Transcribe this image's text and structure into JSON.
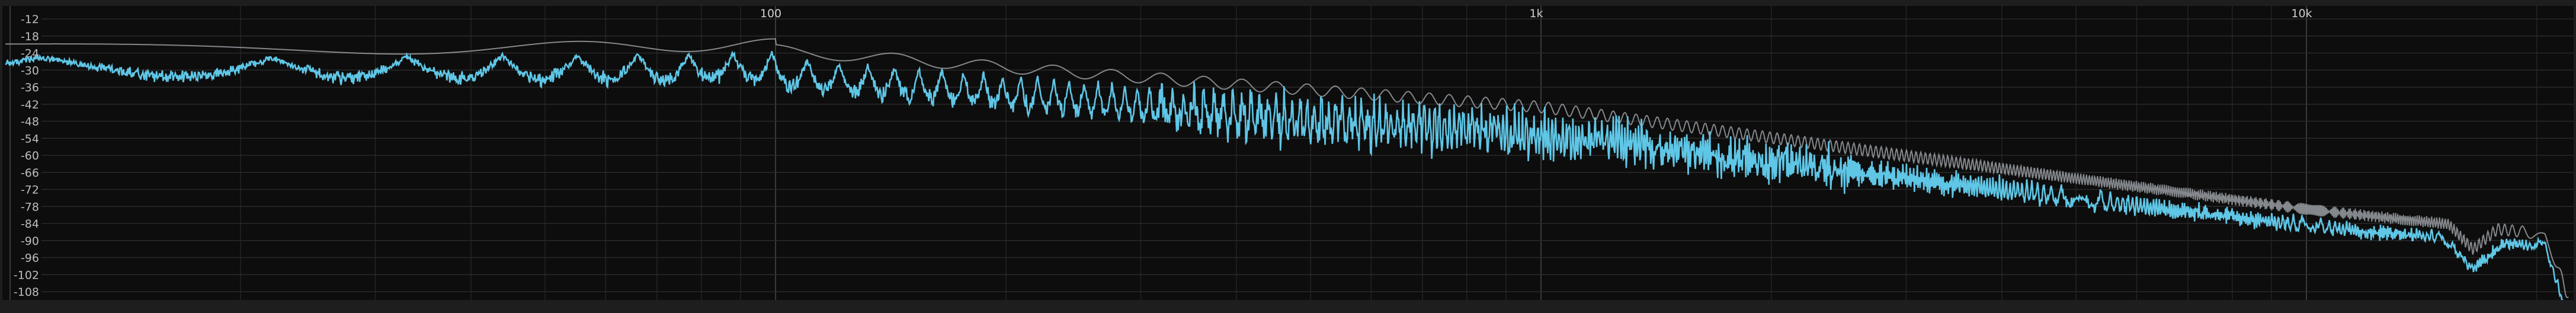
{
  "analyzer": {
    "db_axis": {
      "min": -108,
      "max": -12,
      "step": 6,
      "labels": [
        "-12",
        "-18",
        "-24",
        "-30",
        "-36",
        "-42",
        "-48",
        "-54",
        "-60",
        "-66",
        "-72",
        "-78",
        "-84",
        "-90",
        "-96",
        "-102",
        "-108"
      ]
    },
    "freq_axis": {
      "scale": "log",
      "min_hz": 10,
      "max_hz": 22000,
      "labels": [
        {
          "hz": 100,
          "text": "100"
        },
        {
          "hz": 1000,
          "text": "1k"
        },
        {
          "hz": 10000,
          "text": "10k"
        }
      ]
    },
    "colors": {
      "background": "#0d0d0d",
      "live_trace": "#5fc6e6",
      "peak_trace": "#9a9fa3",
      "grid": "#2a2a2a"
    }
  }
}
